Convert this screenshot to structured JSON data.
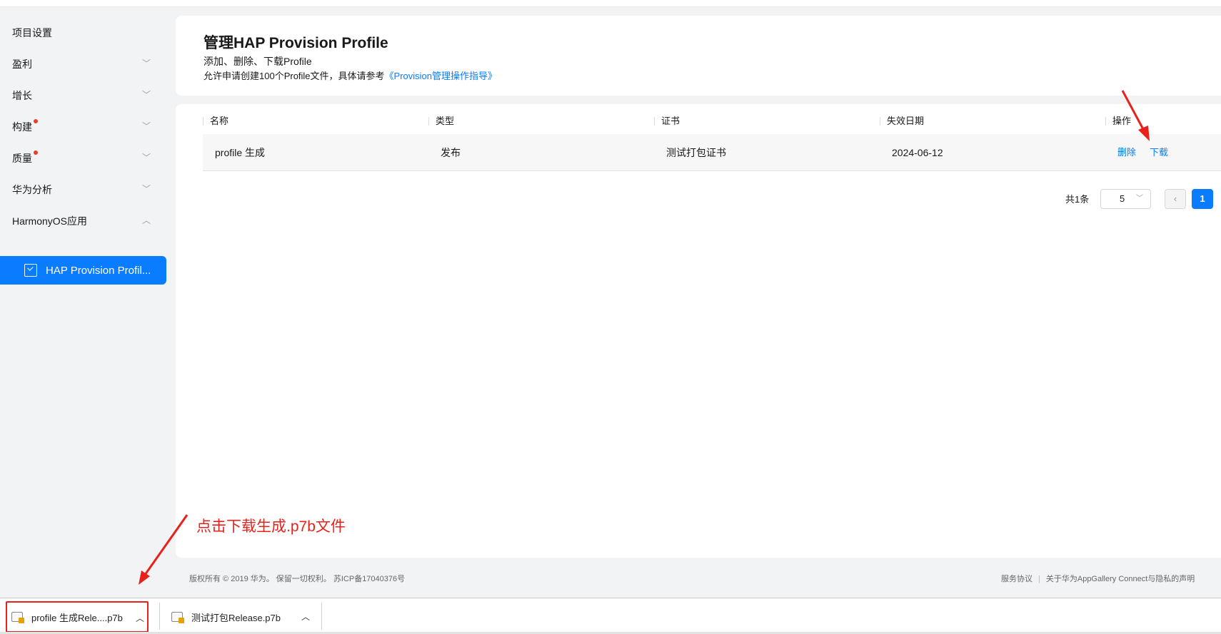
{
  "sidebar": {
    "items": [
      {
        "label": "项目设置",
        "expandable": false,
        "badge": false
      },
      {
        "label": "盈利",
        "expandable": true,
        "badge": false
      },
      {
        "label": "增长",
        "expandable": true,
        "badge": false
      },
      {
        "label": "构建",
        "expandable": true,
        "badge": true
      },
      {
        "label": "质量",
        "expandable": true,
        "badge": true
      },
      {
        "label": "华为分析",
        "expandable": true,
        "badge": false
      },
      {
        "label": "HarmonyOS应用",
        "expandable": true,
        "expanded": true,
        "badge": false
      }
    ],
    "active_item": {
      "label": "HAP Provision Profil...",
      "icon": "document-icon"
    },
    "badge_color": "#e84026"
  },
  "header": {
    "title": "管理HAP Provision Profile",
    "subtitle": "添加、删除、下载Profile",
    "note_prefix": "允许申请创建100个Profile文件，具体请参考",
    "note_link": "《Provision管理操作指导》"
  },
  "table": {
    "columns": [
      "名称",
      "类型",
      "证书",
      "失效日期",
      "操作"
    ],
    "rows": [
      {
        "name": "profile 生成",
        "type": "发布",
        "certificate": "测试打包证书",
        "expiry": "2024-06-12",
        "actions": {
          "delete": "删除",
          "download": "下载"
        }
      }
    ]
  },
  "pagination": {
    "total": "共1条",
    "page_size": "5",
    "current_page": "1"
  },
  "footer": {
    "copyright": "版权所有 © 2019 华为。 保留一切权利。 苏ICP备17040376号",
    "service_agreement": "服务协议",
    "privacy": "关于华为AppGallery Connect与隐私的声明"
  },
  "annotation": {
    "text": "点击下载生成.p7b文件",
    "color": "#e8211b"
  },
  "downloads": [
    {
      "filename": "profile 生成Rele....p7b",
      "highlighted": true
    },
    {
      "filename": "测试打包Release.p7b",
      "highlighted": false
    }
  ],
  "colors": {
    "accent": "#0a7cff",
    "annotation": "#e8211b"
  }
}
